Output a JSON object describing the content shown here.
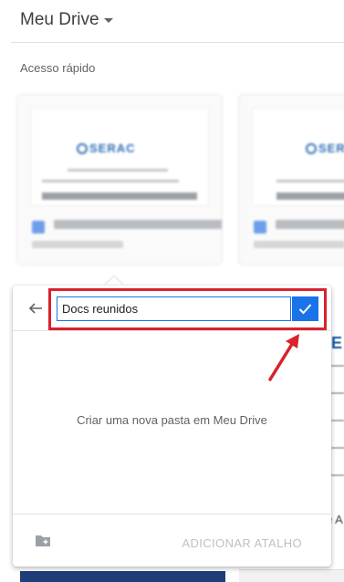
{
  "header": {
    "title": "Meu Drive"
  },
  "quick_access": {
    "label": "Acesso rápido",
    "card_logo": "SERAC"
  },
  "dialog": {
    "folder_name_value": "Docs reunidos",
    "empty_message": "Criar uma nova pasta em Meu Drive",
    "add_shortcut_label": "ADICIONAR ATALHO"
  },
  "background": {
    "right_logo": "E",
    "right_text": "e A"
  },
  "icons": {
    "header": "chevron-down-icon",
    "back": "arrow-left-icon",
    "confirm": "check-icon",
    "new_folder": "new-folder-icon"
  },
  "colors": {
    "accent": "#1a73e8",
    "annotation": "#d9222a"
  }
}
